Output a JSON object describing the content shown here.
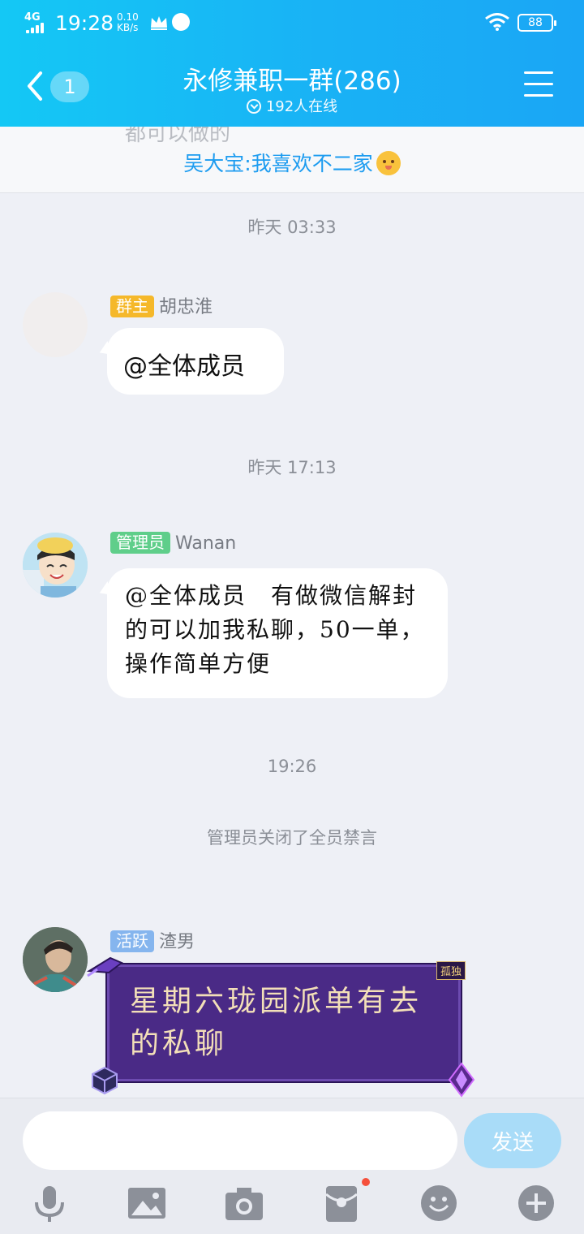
{
  "status_bar": {
    "network": "4G",
    "time": "19:28",
    "speed_value": "0.10",
    "speed_unit": "KB/s",
    "battery": "88"
  },
  "header": {
    "back_count": "1",
    "title": "永修兼职一群(286)",
    "online": "192人在线"
  },
  "notice": {
    "ghost_text": "都可以做的",
    "text": "吴大宝:我喜欢不二家"
  },
  "messages": {
    "ts1": "昨天 03:33",
    "m1": {
      "badge": "群主",
      "badge_color": "#f5b82a",
      "sender": "胡忠淮",
      "text": "@全体成员"
    },
    "ts2": "昨天 17:13",
    "m2": {
      "badge": "管理员",
      "badge_color": "#5fce8a",
      "sender": "Wanan",
      "text": "@全体成员　有做微信解封的可以加我私聊，50一单，操作简单方便"
    },
    "ts3": "19:26",
    "sys": "管理员关闭了全员禁言",
    "m3": {
      "badge": "活跃",
      "badge_color": "#85b5ee",
      "sender": "渣男",
      "text": "星期六珑园派单有去的私聊",
      "frame_tag": "孤独"
    }
  },
  "composer": {
    "placeholder": "",
    "send_label": "发送"
  },
  "toolbar": [
    "microphone-icon",
    "image-icon",
    "camera-icon",
    "red-packet-icon",
    "emoji-icon",
    "plus-icon"
  ]
}
